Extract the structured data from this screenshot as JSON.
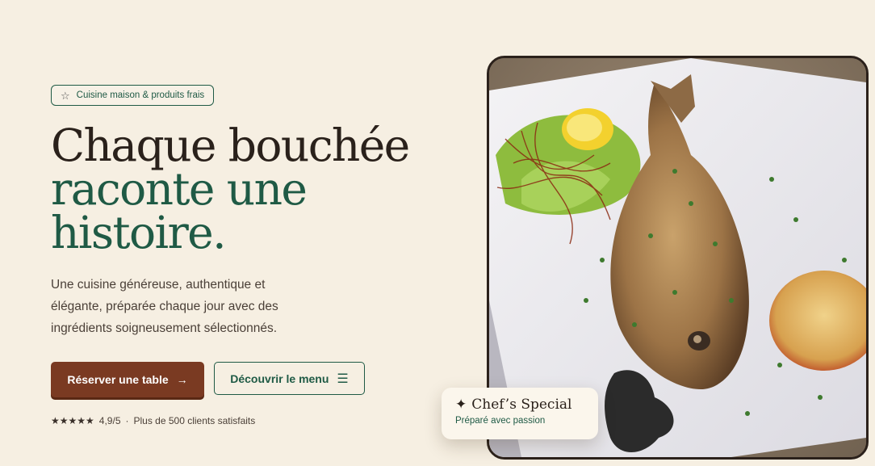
{
  "badge": {
    "icon": "star-outline-icon",
    "text": "Cuisine maison & produits frais"
  },
  "headline": {
    "line1": "Chaque bouchée",
    "line2": "raconte une",
    "line3": "histoire."
  },
  "description": "Une cuisine généreuse, authentique et élégante, préparée chaque jour avec des ingrédients soigneusement sélectionnés.",
  "actions": {
    "reserve_label": "Réserver une table",
    "reserve_icon": "arrow-right-icon",
    "menu_label": "Découvrir le menu",
    "menu_icon": "menu-lines-icon"
  },
  "rating": {
    "stars": "★★★★★",
    "score": "4,9/5",
    "separator": "·",
    "text": "Plus de 500 clients satisfaits"
  },
  "chef_card": {
    "sparkle": "✦",
    "title": "Chef’s Special",
    "subtitle": "Préparé avec passion"
  },
  "colors": {
    "background": "#f6efe2",
    "primary": "#7a3a22",
    "accent_green": "#1f5a45",
    "text_dark": "#2a211b"
  }
}
